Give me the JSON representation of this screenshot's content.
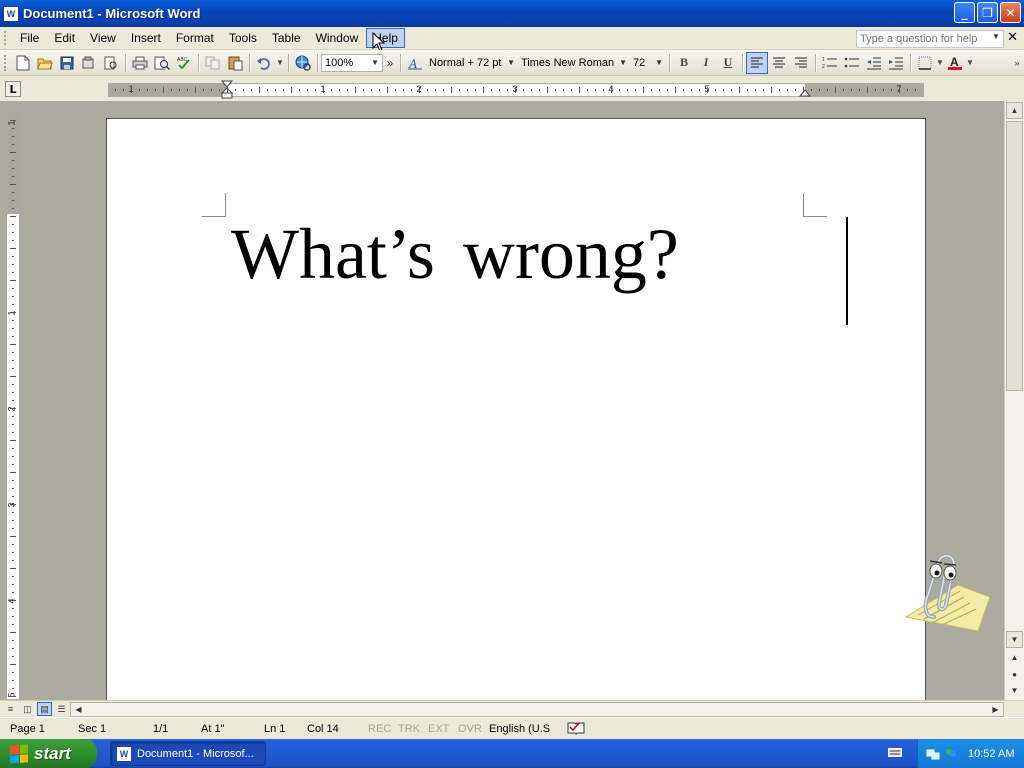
{
  "window": {
    "title": "Document1 - Microsoft Word",
    "app_icon": "W",
    "min_glyph": "_",
    "max_glyph": "❐",
    "close_glyph": "✕"
  },
  "menubar": {
    "items": [
      {
        "label": "File"
      },
      {
        "label": "Edit"
      },
      {
        "label": "View"
      },
      {
        "label": "Insert"
      },
      {
        "label": "Format"
      },
      {
        "label": "Tools"
      },
      {
        "label": "Table"
      },
      {
        "label": "Window"
      },
      {
        "label": "Help"
      }
    ],
    "active": "Help",
    "help_placeholder": "Type a question for help",
    "doc_close_glyph": "✕"
  },
  "toolbar": {
    "zoom": "100%",
    "style": "Normal + 72 pt",
    "font": "Times New Roman",
    "size": "72",
    "bold": "B",
    "italic": "I",
    "underline": "U",
    "overflow_glyph": "»",
    "font_color": "#e81123"
  },
  "ruler": {
    "h_numbers": [
      "1",
      "1",
      "2",
      "3",
      "4",
      "5",
      "7"
    ],
    "v_numbers": [
      "1",
      "1",
      "2",
      "3",
      "4",
      "5"
    ],
    "tab_selector": "L"
  },
  "document": {
    "text": "What’s  wrong?"
  },
  "statusbar": {
    "page": "Page 1",
    "sec": "Sec 1",
    "pages": "1/1",
    "at": "At 1\"",
    "ln": "Ln 1",
    "col": "Col 14",
    "rec": "REC",
    "trk": "TRK",
    "ext": "EXT",
    "ovr": "OVR",
    "language": "English (U.S"
  },
  "taskbar": {
    "start": "start",
    "task": "Document1 - Microsof...",
    "clock": "10:52 AM"
  }
}
